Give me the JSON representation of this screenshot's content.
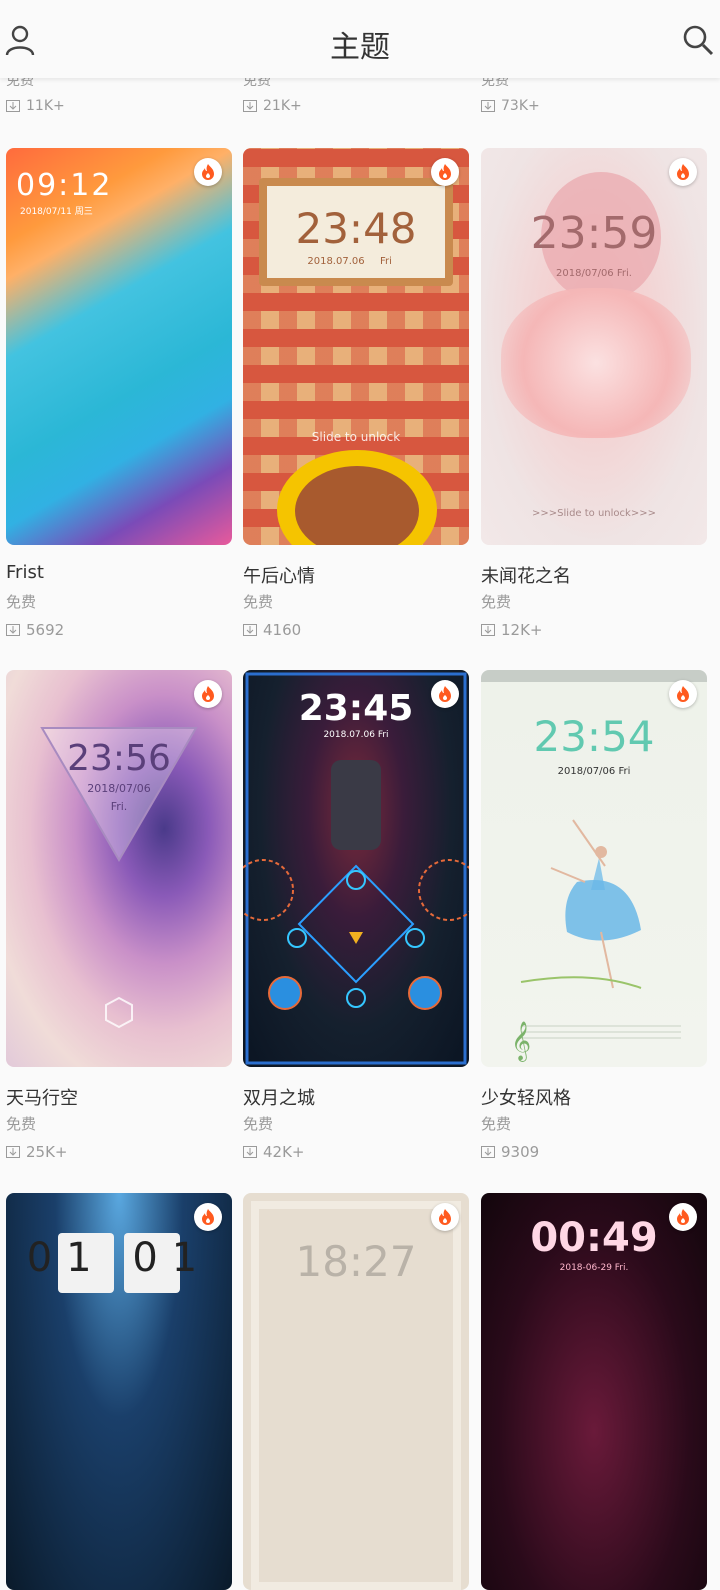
{
  "header": {
    "title": "主题"
  },
  "top_row": [
    {
      "price": "免费",
      "downloads": "11K+"
    },
    {
      "price": "免费",
      "downloads": "21K+"
    },
    {
      "price": "免费",
      "downloads": "73K+"
    }
  ],
  "themes": [
    {
      "name": "Frist",
      "price": "免费",
      "downloads": "5692",
      "clock": "09:12",
      "date": "2018/07/11 周三"
    },
    {
      "name": "午后心情",
      "price": "免费",
      "downloads": "4160",
      "clock": "23:48",
      "date": "2018.07.06",
      "day": "Fri",
      "extra": "Slide to unlock"
    },
    {
      "name": "未闻花之名",
      "price": "免费",
      "downloads": "12K+",
      "clock": "23:59",
      "date": "2018/07/06 Fri.",
      "extra": ">>>Slide to unlock>>>"
    },
    {
      "name": "天马行空",
      "price": "免费",
      "downloads": "25K+",
      "clock": "23:56",
      "date": "2018/07/06",
      "day": "Fri."
    },
    {
      "name": "双月之城",
      "price": "免费",
      "downloads": "42K+",
      "clock": "23:45",
      "date": "2018.07.06 Fri"
    },
    {
      "name": "少女轻风格",
      "price": "免费",
      "downloads": "9309",
      "clock": "23:54",
      "date": "2018/07/06 Fri"
    },
    {
      "clock": "01 01"
    },
    {
      "clock": "18:27"
    },
    {
      "clock": "00:49",
      "date": "2018-06-29 Fri."
    }
  ]
}
